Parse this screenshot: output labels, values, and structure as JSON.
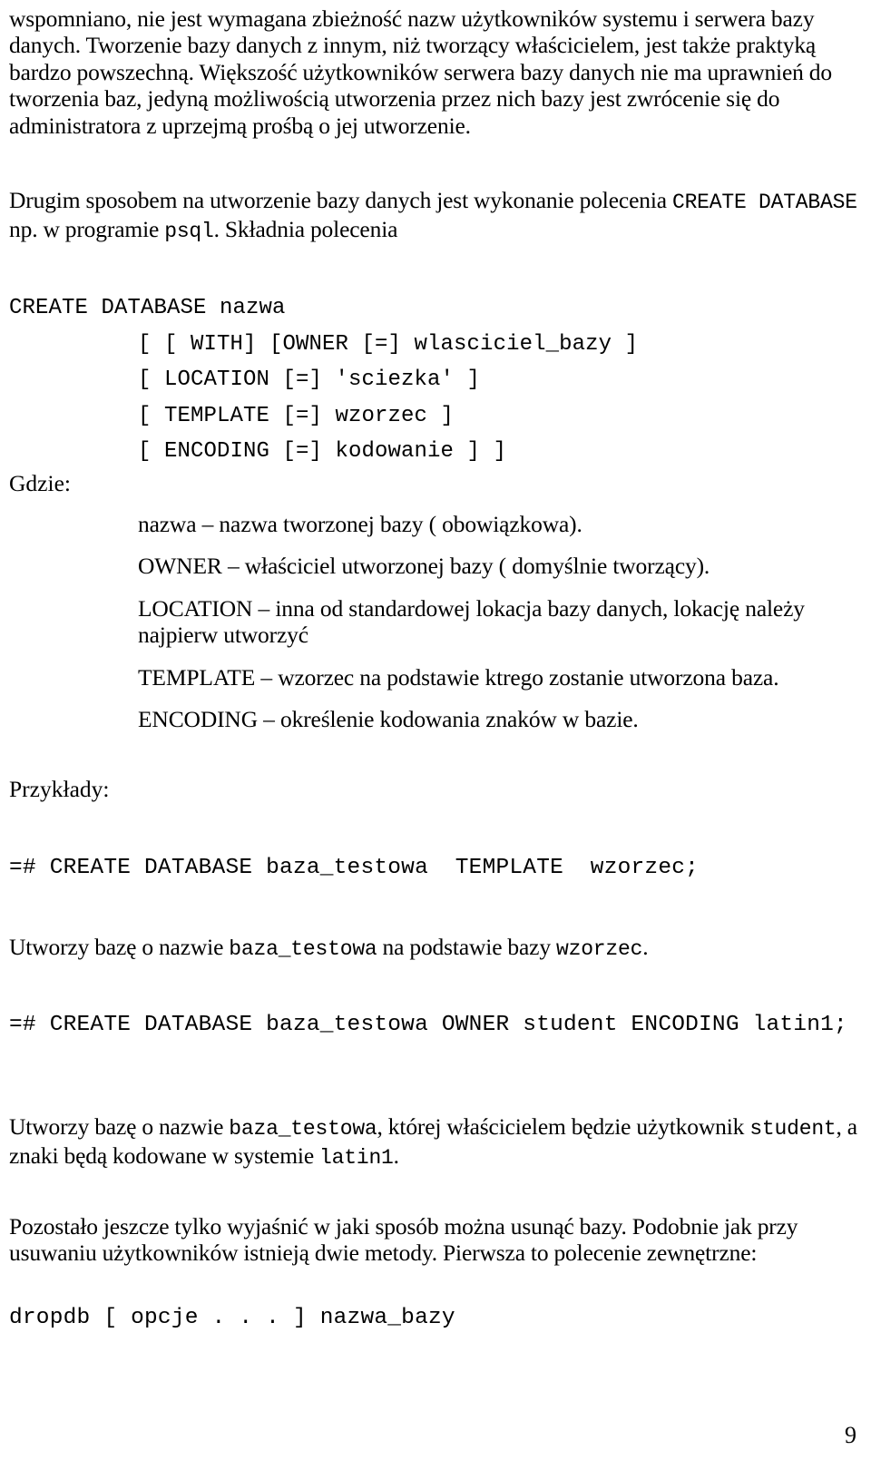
{
  "document": {
    "page_number": "9",
    "language": "pl"
  },
  "intro_paragraph": {
    "line1_pre": "wspomniano, nie jest wymagana zbieżność nazw użytkowników systemu i serwera bazy danych. Tworzenie bazy danych z innym, niż tworzący właścicielem, jest także praktyką bardzo powszechną. Większość użytkowników serwera bazy danych nie ma uprawnień do tworzenia baz, jedyną możliwością utworzenia przez nich bazy jest zwrócenie się do administratora z uprzejmą prośbą o jej utworzenie."
  },
  "second_paragraph": {
    "text_1": "Drugim sposobem na utworzenie bazy danych jest wykonanie polecenia ",
    "code_1": "CREATE DATABASE",
    "text_2": " np. w programie ",
    "code_2": "psql",
    "text_3": ". Składnia polecenia"
  },
  "syntax_block": {
    "lines": [
      "CREATE DATABASE nazwa",
      "[ [ WITH] [OWNER [=] wlasciciel_bazy ]",
      "[ LOCATION [=] 'sciezka' ]",
      "[ TEMPLATE [=] wzorzec ]",
      "[ ENCODING [=] kodowanie ] ]"
    ]
  },
  "where_label": "Gdzie:",
  "definitions": [
    {
      "term": "nazwa",
      "term_mono": false,
      "description": " – nazwa tworzonej bazy ( obowiązkowa)."
    },
    {
      "term": "OWNER",
      "term_mono": false,
      "description": " – właściciel  utworzonej bazy ( domyślnie tworzący)."
    },
    {
      "term": "LOCATION",
      "term_mono": false,
      "description": " – inna od standardowej lokacja bazy danych, lokację należy najpierw utworzyć"
    },
    {
      "term": "TEMPLATE",
      "term_mono": false,
      "description": " – wzorzec na podstawie ktrego zostanie utworzona baza."
    },
    {
      "term": "ENCODING",
      "term_mono": false,
      "description": " – określenie kodowania znaków w bazie."
    }
  ],
  "examples_label": "Przykłady:",
  "example_1": {
    "command": "=# CREATE DATABASE baza_testowa  TEMPLATE  wzorzec;",
    "explanation": {
      "text_1": "Utworzy bazę o nazwie ",
      "code_1": "baza_testowa",
      "text_2": " na podstawie bazy ",
      "code_2": "wzorzec",
      "text_3": "."
    }
  },
  "example_2": {
    "command": "=# CREATE DATABASE baza_testowa OWNER student ENCODING latin1;",
    "explanation": {
      "text_1": "Utworzy bazę o nazwie ",
      "code_1": "baza_testowa",
      "text_2": ", której właścicielem będzie użytkownik ",
      "code_2": "student",
      "text_3": ", a znaki będą kodowane w systemie ",
      "code_3": "latin1",
      "text_4": "."
    }
  },
  "closing_paragraph": {
    "text": "Pozostało jeszcze tylko wyjaśnić w jaki sposób można usunąć bazy. Podobnie jak przy usuwaniu użytkowników istnieją dwie metody. Pierwsza to polecenie zewnętrzne:"
  },
  "dropdb_command": "dropdb [ opcje . . . ] nazwa_bazy"
}
